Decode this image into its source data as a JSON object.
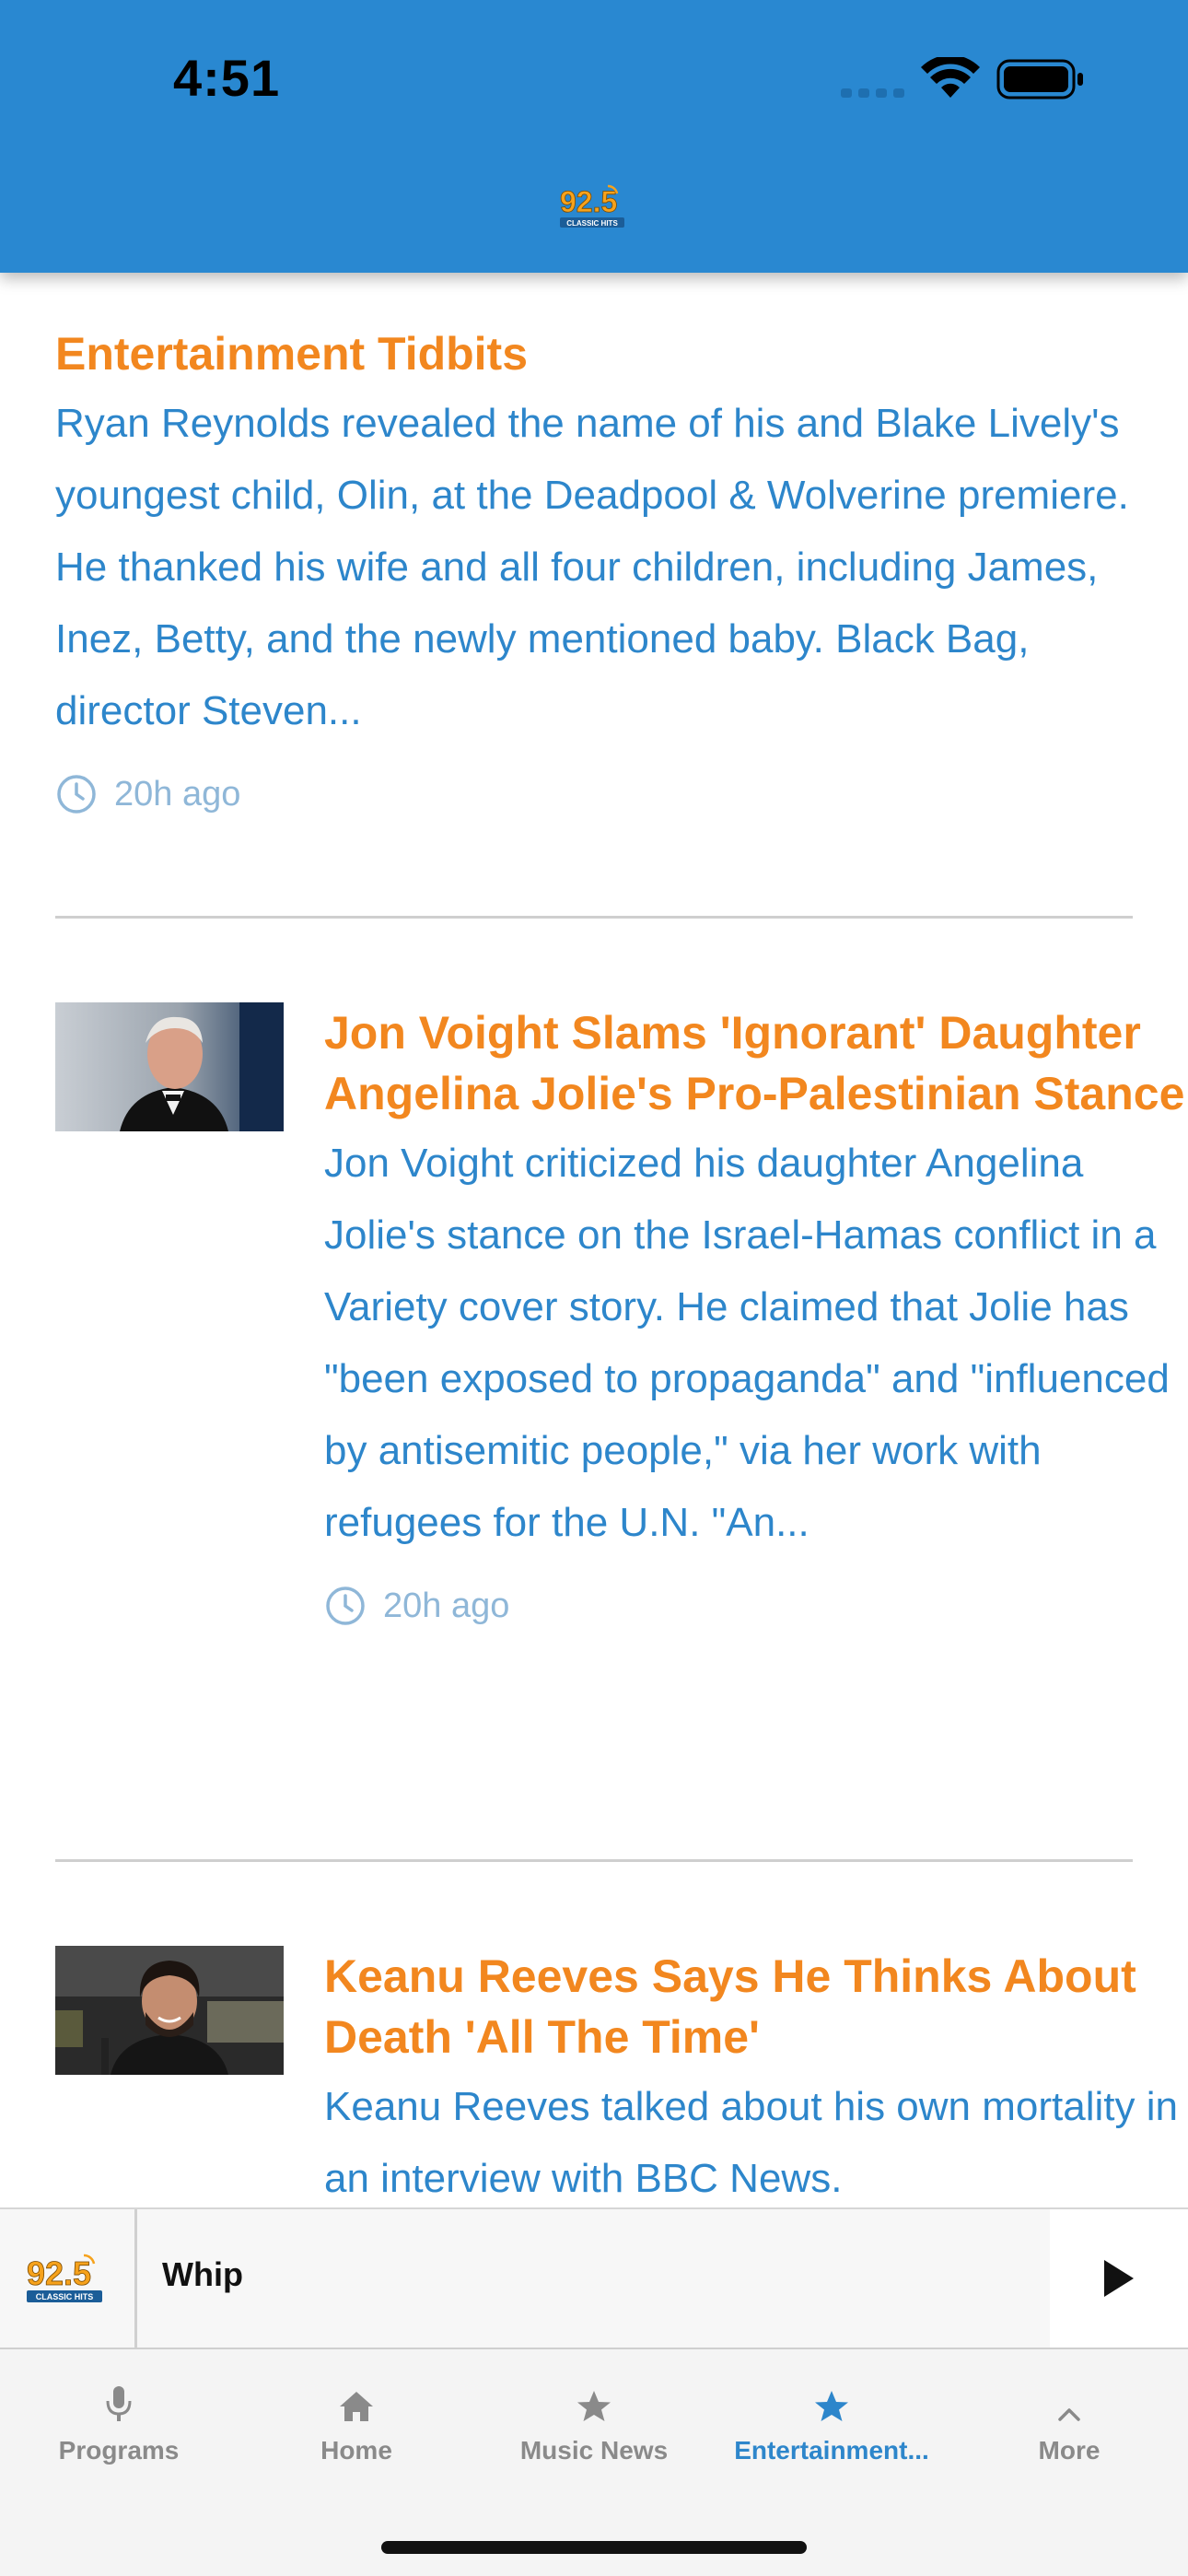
{
  "status_bar": {
    "time": "4:51"
  },
  "header": {
    "logo_text": "92.5",
    "logo_subtext": "CLASSIC HITS"
  },
  "feed": {
    "articles": [
      {
        "title": "Entertainment Tidbits",
        "summary": "Ryan Reynolds revealed the name of his and Blake Lively's youngest child, Olin, at the Deadpool & Wolverine premiere. He thanked his wife and all four children, including James, Inez, Betty, and the newly mentioned baby. Black Bag, director Steven...",
        "time": "20h ago"
      },
      {
        "title": "Jon Voight Slams 'Ignorant' Daughter Angelina Jolie's Pro-Palestinian Stance",
        "summary": "Jon Voight criticized his daughter Angelina Jolie's stance on the Israel-Hamas conflict in a Variety cover story. He claimed that Jolie has \"been exposed to propaganda\" and \"influenced by antisemitic people,\" via her work with refugees for the U.N. \"An...",
        "time": "20h ago"
      },
      {
        "title": "Keanu Reeves Says He Thinks About Death 'All The Time'",
        "summary": "Keanu Reeves talked about his own mortality in an interview with BBC News.",
        "time": ""
      }
    ]
  },
  "player": {
    "title": "Whip",
    "logo_text": "92.5",
    "logo_subtext": "CLASSIC HITS"
  },
  "tabbar": {
    "tabs": [
      {
        "label": "Programs",
        "icon": "microphone-icon",
        "active": false
      },
      {
        "label": "Home",
        "icon": "home-icon",
        "active": false
      },
      {
        "label": "Music News",
        "icon": "star-icon",
        "active": false
      },
      {
        "label": "Entertainment...",
        "icon": "star-icon",
        "active": true
      },
      {
        "label": "More",
        "icon": "chevron-up-icon",
        "active": false
      }
    ]
  },
  "colors": {
    "header_bg": "#2988d1",
    "title": "#f2871f",
    "summary": "#2d86cb",
    "meta": "#8fb7d8",
    "tab_active": "#2d86cb",
    "tab_inactive": "#8a8a8a"
  }
}
